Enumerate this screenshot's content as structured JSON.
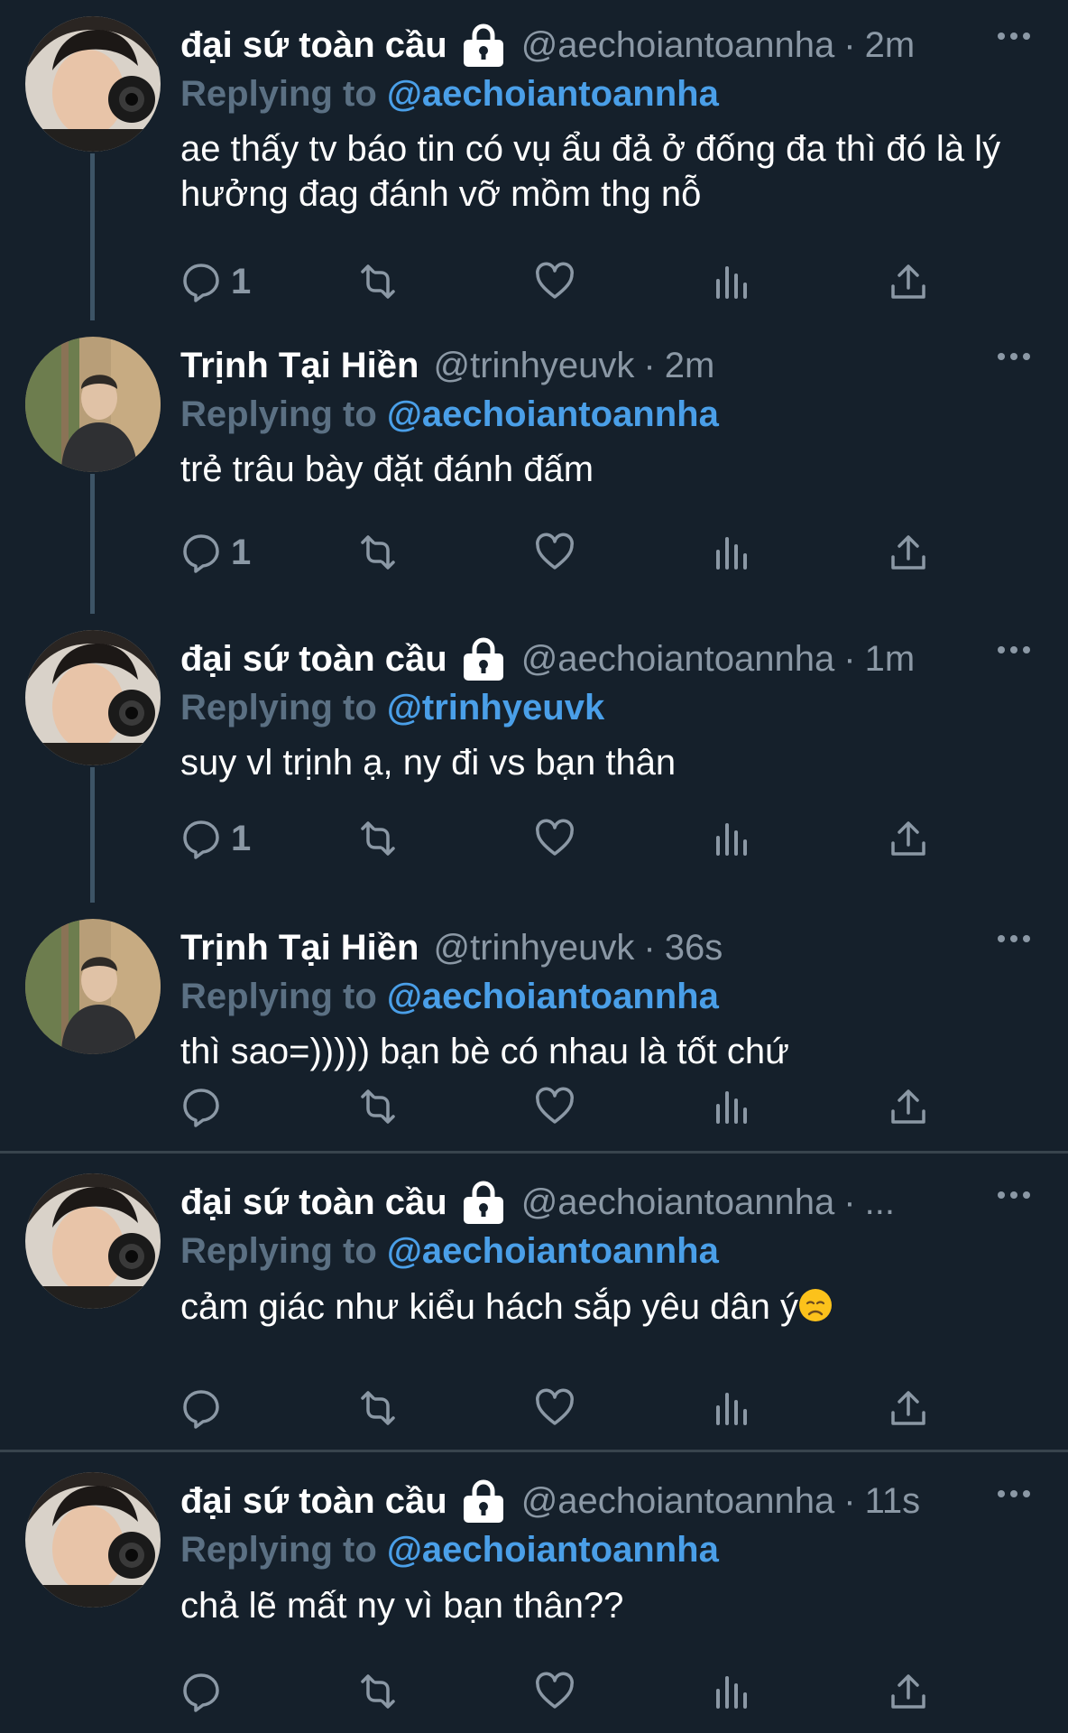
{
  "colors": {
    "background": "#15202b",
    "text": "#ffffff",
    "secondary": "#8b98a5",
    "reply_label": "#5b7083",
    "link": "#4a9fe8",
    "thread_line": "#3d5466",
    "divider": "#38444d"
  },
  "reply_label": "Replying to",
  "sep": "·",
  "tweets": [
    {
      "avatar_icon": "avatar-young-man-with-camera",
      "name": "đại sứ toàn cầu",
      "locked": true,
      "handle": "@aechoiantoannha",
      "time": "2m",
      "reply_to": "@aechoiantoannha",
      "text": "ae thấy tv báo tin có vụ ẩu đả ở đống đa thì đó là lý hưởng đag đánh vỡ mồm thg nỗ",
      "reply_count": "1"
    },
    {
      "avatar_icon": "avatar-man-in-dark-jacket",
      "name": "Trịnh Tại Hiền",
      "locked": false,
      "handle": "@trinhyeuvk",
      "time": "2m",
      "reply_to": "@aechoiantoannha",
      "text": "trẻ trâu bày đặt đánh đấm",
      "reply_count": "1"
    },
    {
      "avatar_icon": "avatar-young-man-with-camera",
      "name": "đại sứ toàn cầu",
      "locked": true,
      "handle": "@aechoiantoannha",
      "time": "1m",
      "reply_to": "@trinhyeuvk",
      "text": "suy vl trịnh ạ, ny đi vs bạn thân",
      "reply_count": "1"
    },
    {
      "avatar_icon": "avatar-man-in-dark-jacket",
      "name": "Trịnh Tại Hiền",
      "locked": false,
      "handle": "@trinhyeuvk",
      "time": "36s",
      "reply_to": "@aechoiantoannha",
      "text": "thì sao=))))) bạn bè có nhau là tốt chứ",
      "reply_count": ""
    },
    {
      "avatar_icon": "avatar-young-man-with-camera",
      "name": "đại sứ toàn cầu",
      "locked": true,
      "handle": "@aechoiantoannha",
      "time": "...",
      "reply_to": "@aechoiantoannha",
      "text": "cảm giác như kiểu hách sắp yêu dân ý",
      "text_emoji": "disappointed-face-emoji",
      "reply_count": ""
    },
    {
      "avatar_icon": "avatar-young-man-with-camera",
      "name": "đại sứ toàn cầu",
      "locked": true,
      "handle": "@aechoiantoannha",
      "time": "11s",
      "reply_to": "@aechoiantoannha",
      "text": "chả lẽ mất ny vì bạn thân??",
      "reply_count": ""
    }
  ]
}
